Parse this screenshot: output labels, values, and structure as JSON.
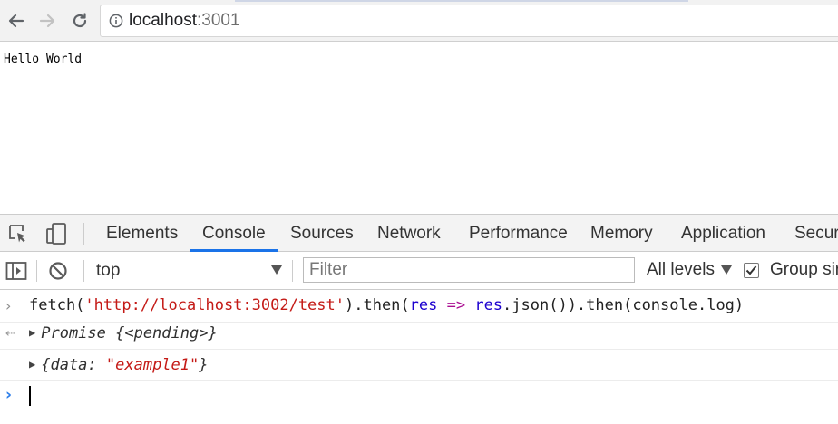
{
  "browser": {
    "url_host": "localhost",
    "url_port": ":3001"
  },
  "page": {
    "body_text": "Hello World"
  },
  "devtools": {
    "tabs": [
      {
        "label": "Elements"
      },
      {
        "label": "Console"
      },
      {
        "label": "Sources"
      },
      {
        "label": "Network"
      },
      {
        "label": "Performance"
      },
      {
        "label": "Memory"
      },
      {
        "label": "Application"
      },
      {
        "label": "Securi"
      }
    ],
    "active_tab": "Console",
    "console_toolbar": {
      "context": "top",
      "filter_placeholder": "Filter",
      "levels": "All levels",
      "group_similar_label": "Group sir",
      "group_similar_checked": true
    },
    "console": {
      "input_line": {
        "prefix": "fetch(",
        "url_string": "'http://localhost:3002/test'",
        "mid1": ").then(",
        "param": "res",
        "arrow": " => ",
        "param2": "res",
        "suffix": ".json()).then(console.log)"
      },
      "promise_result": "Promise {<pending>}",
      "object_output": {
        "open": "{data: ",
        "value": "\"example1\"",
        "close": "}"
      }
    },
    "accent_color": "#1a73e8"
  }
}
